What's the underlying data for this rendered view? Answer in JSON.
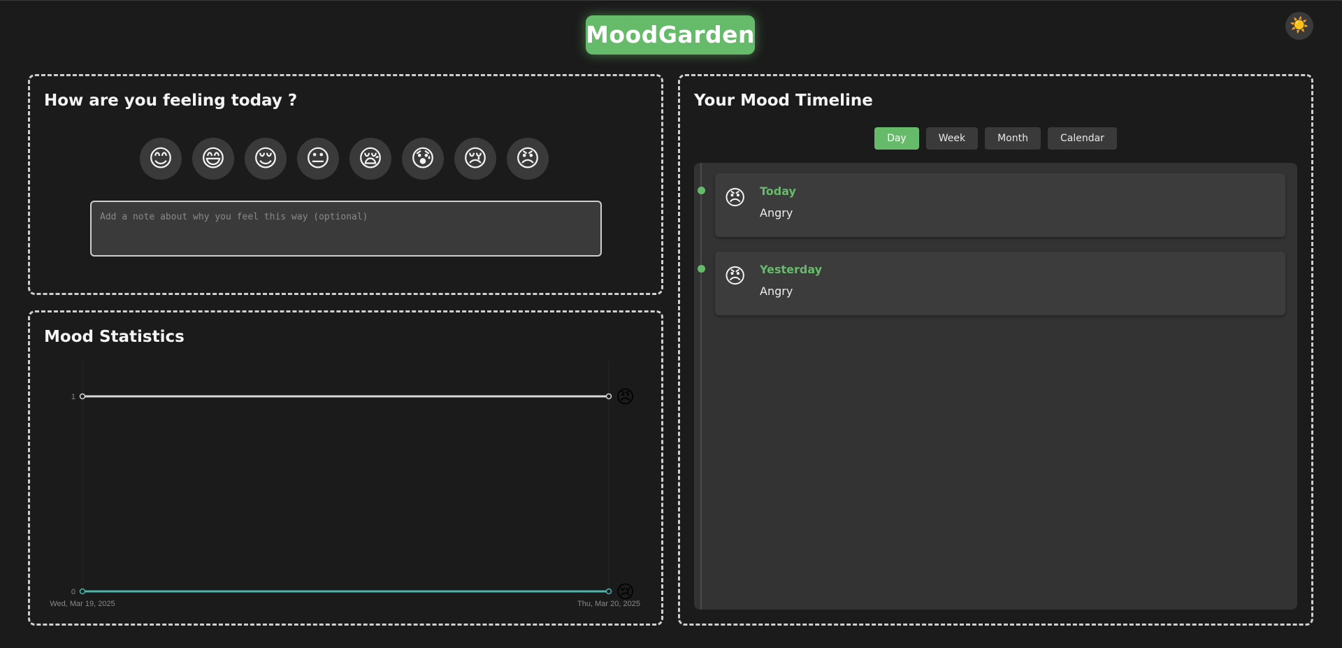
{
  "app": {
    "title": "MoodGarden",
    "theme_toggle_icon": "☀️"
  },
  "checkin": {
    "title": "How are you feeling today ?",
    "moods": [
      {
        "emoji": "😊",
        "icon": "smiling-face-icon"
      },
      {
        "emoji": "😄",
        "icon": "grinning-face-icon"
      },
      {
        "emoji": "😌",
        "icon": "relieved-face-icon"
      },
      {
        "emoji": "😐",
        "icon": "neutral-face-icon"
      },
      {
        "emoji": "😪",
        "icon": "sleepy-face-icon"
      },
      {
        "emoji": "😰",
        "icon": "anxious-face-icon"
      },
      {
        "emoji": "😢",
        "icon": "crying-face-icon"
      },
      {
        "emoji": "😠",
        "icon": "angry-face-icon"
      }
    ],
    "note_placeholder": "Add a note about why you feel this way (optional)",
    "note_value": ""
  },
  "stats": {
    "title": "Mood Statistics",
    "chart_data": {
      "type": "line",
      "x": [
        "Wed, Mar 19, 2025",
        "Thu, Mar 20, 2025"
      ],
      "ylim": [
        0,
        1
      ],
      "y_ticks": [
        "0",
        "1"
      ],
      "grid": true,
      "series": [
        {
          "emoji": "😠",
          "color": "#d9d9d9",
          "values": [
            1,
            1
          ]
        },
        {
          "emoji": "😢",
          "color": "#4db6ac",
          "values": [
            0,
            0
          ]
        }
      ]
    }
  },
  "timeline": {
    "title": "Your Mood Timeline",
    "tabs": [
      "Day",
      "Week",
      "Month",
      "Calendar"
    ],
    "active_tab": "Day",
    "entries": [
      {
        "day": "Today",
        "emoji": "😠",
        "mood": "Angry"
      },
      {
        "day": "Yesterday",
        "emoji": "😠",
        "mood": "Angry"
      }
    ]
  },
  "colors": {
    "accent": "#66bb6a",
    "background": "#1b1b1b",
    "panel_border": "#cfcfcf"
  }
}
